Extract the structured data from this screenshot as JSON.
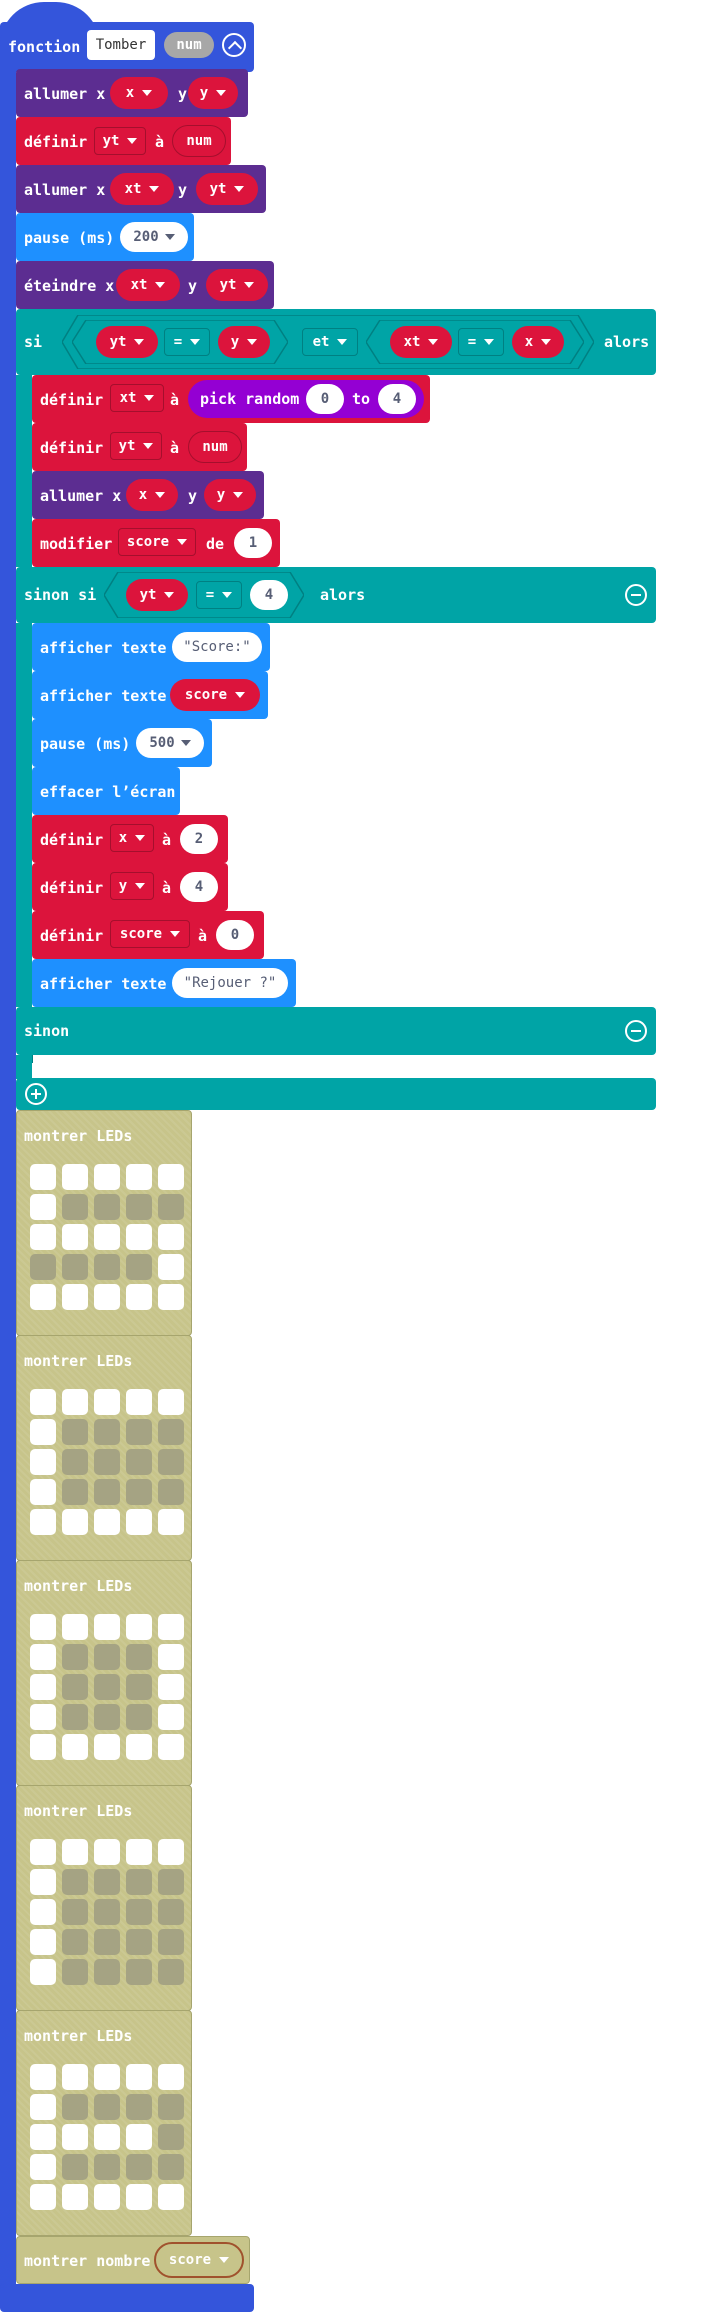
{
  "function_block": {
    "keyword": "fonction",
    "name": "Tomber",
    "param": "num"
  },
  "blocks": {
    "b1": {
      "label": "allumer x",
      "x": "x",
      "ylabel": "y",
      "y": "y"
    },
    "b2": {
      "label": "définir",
      "var": "yt",
      "to": "à",
      "value": "num"
    },
    "b3": {
      "label": "allumer x",
      "x": "xt",
      "ylabel": "y",
      "y": "yt"
    },
    "b4": {
      "label": "pause (ms)",
      "value": "200"
    },
    "b5": {
      "label": "éteindre x",
      "x": "xt",
      "ylabel": "y",
      "y": "yt"
    }
  },
  "if_block": {
    "if_label": "si",
    "cond_left_a": "yt",
    "cond_op_a": "=",
    "cond_right_a": "y",
    "and_label": "et",
    "cond_left_b": "xt",
    "cond_op_b": "=",
    "cond_right_b": "x",
    "then_label": "alors",
    "branch1": {
      "s1": {
        "label": "définir",
        "var": "xt",
        "to": "à",
        "rand_label": "pick random",
        "from": "0",
        "to_label": "to",
        "to_val": "4"
      },
      "s2": {
        "label": "définir",
        "var": "yt",
        "to": "à",
        "value": "num"
      },
      "s3": {
        "label": "allumer x",
        "x": "x",
        "ylabel": "y",
        "y": "y"
      },
      "s4": {
        "label": "modifier",
        "var": "score",
        "de": "de",
        "value": "1"
      }
    },
    "elseif_label": "sinon si",
    "elseif_left": "yt",
    "elseif_op": "=",
    "elseif_right": "4",
    "elseif_then": "alors",
    "branch2": {
      "t1": {
        "label": "afficher texte",
        "value": "\"Score:\""
      },
      "t2": {
        "label": "afficher texte",
        "value": "score"
      },
      "t3": {
        "label": "pause (ms)",
        "value": "500"
      },
      "t4": {
        "label": "effacer l’écran"
      },
      "t5": {
        "label": "définir",
        "var": "x",
        "to": "à",
        "value": "2"
      },
      "t6": {
        "label": "définir",
        "var": "y",
        "to": "à",
        "value": "4"
      },
      "t7": {
        "label": "définir",
        "var": "score",
        "to": "à",
        "value": "0"
      },
      "t8": {
        "label": "afficher texte",
        "value": "\"Rejouer ?\""
      }
    },
    "else_label": "sinon"
  },
  "led_blocks": [
    {
      "label": "montrer LEDs",
      "grid": [
        [
          0,
          0,
          0,
          0,
          0
        ],
        [
          0,
          1,
          1,
          1,
          1
        ],
        [
          0,
          0,
          0,
          0,
          0
        ],
        [
          1,
          1,
          1,
          1,
          0
        ],
        [
          0,
          0,
          0,
          0,
          0
        ]
      ]
    },
    {
      "label": "montrer LEDs",
      "grid": [
        [
          0,
          0,
          0,
          0,
          0
        ],
        [
          0,
          1,
          1,
          1,
          1
        ],
        [
          0,
          1,
          1,
          1,
          1
        ],
        [
          0,
          1,
          1,
          1,
          1
        ],
        [
          0,
          0,
          0,
          0,
          0
        ]
      ]
    },
    {
      "label": "montrer LEDs",
      "grid": [
        [
          0,
          0,
          0,
          0,
          0
        ],
        [
          0,
          1,
          1,
          1,
          0
        ],
        [
          0,
          1,
          1,
          1,
          0
        ],
        [
          0,
          1,
          1,
          1,
          0
        ],
        [
          0,
          0,
          0,
          0,
          0
        ]
      ]
    },
    {
      "label": "montrer LEDs",
      "grid": [
        [
          0,
          0,
          0,
          0,
          0
        ],
        [
          0,
          1,
          1,
          1,
          1
        ],
        [
          0,
          1,
          1,
          1,
          1
        ],
        [
          0,
          1,
          1,
          1,
          1
        ],
        [
          0,
          1,
          1,
          1,
          1
        ]
      ]
    },
    {
      "label": "montrer LEDs",
      "grid": [
        [
          0,
          0,
          0,
          0,
          0
        ],
        [
          0,
          1,
          1,
          1,
          1
        ],
        [
          0,
          0,
          0,
          0,
          1
        ],
        [
          0,
          1,
          1,
          1,
          1
        ],
        [
          0,
          0,
          0,
          0,
          0
        ]
      ]
    }
  ],
  "show_number": {
    "label": "montrer nombre",
    "value": "score"
  },
  "colors": {
    "function": "#3455db",
    "led": "#5c2d91",
    "variable": "#dc143c",
    "basic": "#1e90ff",
    "logic": "#00a4a6",
    "math": "#9400d3",
    "ledshow": "#c7c48a"
  }
}
